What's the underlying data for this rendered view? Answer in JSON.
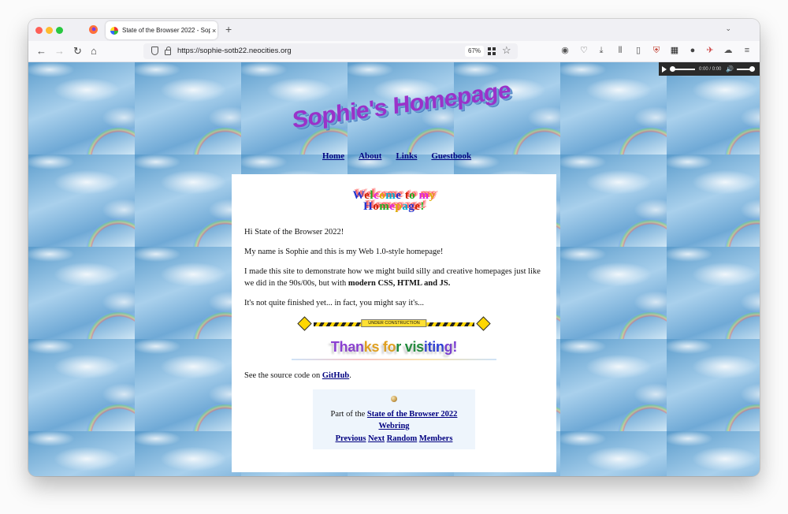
{
  "browser": {
    "tab": {
      "title": "State of the Browser 2022 - Sop",
      "close": "×"
    },
    "new_tab": "+",
    "tab_list": "⌄",
    "nav": {
      "back": "←",
      "forward": "→",
      "reload": "↻",
      "home": "⌂"
    },
    "url": "https://sophie-sotb22.neocities.org",
    "zoom": "67%",
    "star": "☆",
    "toolbar_icons": [
      "account-icon",
      "pocket-icon",
      "download-icon",
      "library-icon",
      "sidebar-icon",
      "ublock-icon",
      "extensions-icon",
      "s-icon",
      "vpn-icon",
      "cloud-icon",
      "menu-icon"
    ]
  },
  "audio_player": {
    "time": "0:00",
    "duration": "0:00"
  },
  "site": {
    "title": "Sophie's Homepage",
    "nav": [
      "Home",
      "About",
      "Links",
      "Guestbook"
    ],
    "welcome_line1": "Welcome to my",
    "welcome_line2": "Homepage!",
    "greeting": "Hi State of the Browser 2022!",
    "intro": "My name is Sophie and this is my Web 1.0-style homepage!",
    "para1_start": "I made this site to demonstrate how we might build silly and creative homepages just like we did in the 90s/00s, but with ",
    "para1_bold": "modern CSS, HTML and JS.",
    "para2": "It's not quite finished yet... in fact, you might say it's...",
    "under_construction": "UNDER CONSTRUCTION",
    "thanks": [
      "Thanks",
      "for",
      "visiting!"
    ],
    "thanks_colors": [
      "#8a3fd1",
      "#e0a020",
      "#1f8a3a",
      "#2a3bd6",
      "#7a3fd1"
    ],
    "source_prefix": "See the source code on ",
    "source_link": "GitHub",
    "source_suffix": ".",
    "webring": {
      "prefix": "Part of the ",
      "link": "State of the Browser 2022",
      "link2": "Webring",
      "links": [
        "Previous",
        "Next",
        "Random",
        "Members"
      ]
    }
  }
}
